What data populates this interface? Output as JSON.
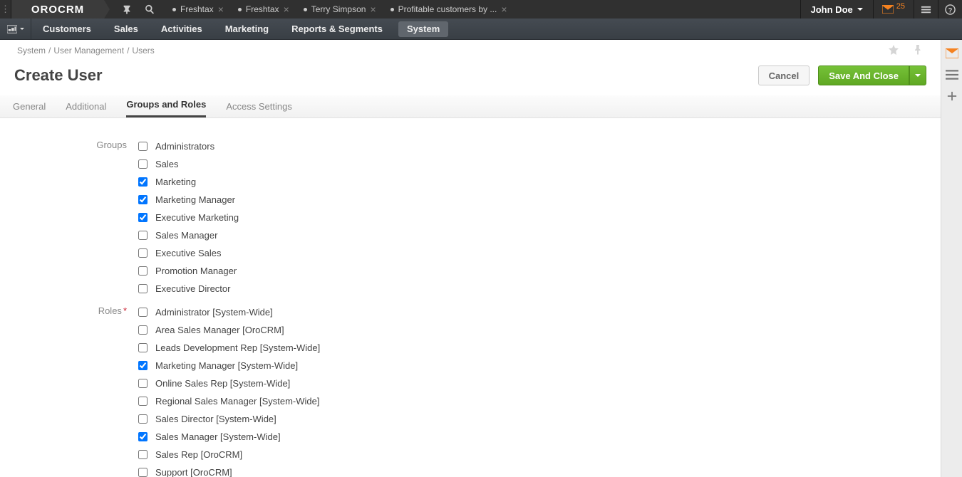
{
  "brand": "OROCRM",
  "top_tabs": [
    {
      "label": "Freshtax"
    },
    {
      "label": "Freshtax"
    },
    {
      "label": "Terry Simpson"
    },
    {
      "label": "Profitable customers by ..."
    }
  ],
  "user_name": "John Doe",
  "mail_count": "25",
  "nav": {
    "items": [
      "Customers",
      "Sales",
      "Activities",
      "Marketing",
      "Reports & Segments",
      "System"
    ],
    "active": "System"
  },
  "breadcrumb": [
    "System",
    "User Management",
    "Users"
  ],
  "page_title": "Create User",
  "buttons": {
    "cancel": "Cancel",
    "save": "Save And Close"
  },
  "form_tabs": [
    {
      "label": "General",
      "active": false
    },
    {
      "label": "Additional",
      "active": false
    },
    {
      "label": "Groups and Roles",
      "active": true
    },
    {
      "label": "Access Settings",
      "active": false
    }
  ],
  "groups": {
    "label": "Groups",
    "items": [
      {
        "label": "Administrators",
        "checked": false
      },
      {
        "label": "Sales",
        "checked": false
      },
      {
        "label": "Marketing",
        "checked": true
      },
      {
        "label": "Marketing Manager",
        "checked": true
      },
      {
        "label": "Executive Marketing",
        "checked": true
      },
      {
        "label": "Sales Manager",
        "checked": false
      },
      {
        "label": "Executive Sales",
        "checked": false
      },
      {
        "label": "Promotion Manager",
        "checked": false
      },
      {
        "label": "Executive Director",
        "checked": false
      }
    ]
  },
  "roles": {
    "label": "Roles",
    "required": true,
    "items": [
      {
        "label": "Administrator [System-Wide]",
        "checked": false
      },
      {
        "label": "Area Sales Manager [OroCRM]",
        "checked": false
      },
      {
        "label": "Leads Development Rep [System-Wide]",
        "checked": false
      },
      {
        "label": "Marketing Manager [System-Wide]",
        "checked": true
      },
      {
        "label": "Online Sales Rep [System-Wide]",
        "checked": false
      },
      {
        "label": "Regional Sales Manager [System-Wide]",
        "checked": false
      },
      {
        "label": "Sales Director [System-Wide]",
        "checked": false
      },
      {
        "label": "Sales Manager [System-Wide]",
        "checked": true
      },
      {
        "label": "Sales Rep [OroCRM]",
        "checked": false
      },
      {
        "label": "Support [OroCRM]",
        "checked": false
      }
    ]
  }
}
